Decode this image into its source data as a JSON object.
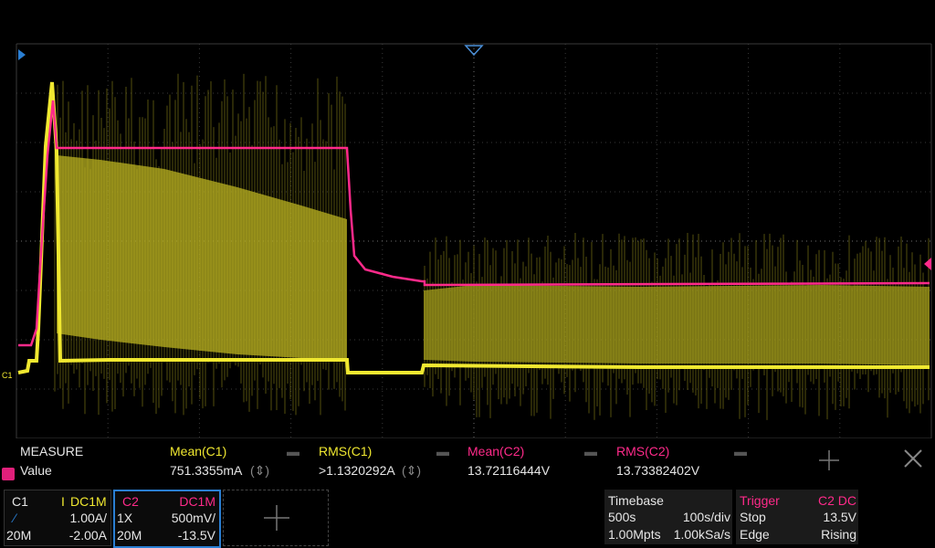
{
  "colors": {
    "ch1": "#f0e830",
    "ch2": "#ff2a8a",
    "grid": "#3a3a3a",
    "accent": "#2a7fd3"
  },
  "markers": {
    "ch1_label": "C1"
  },
  "measure": {
    "header": "MEASURE",
    "row_label": "Value",
    "columns": [
      {
        "name": "Mean(C1)",
        "value": "751.3355mA",
        "stat_icon": "updown-icon"
      },
      {
        "name": "RMS(C1)",
        "value": ">1.1320292A",
        "stat_icon": "updown-icon"
      },
      {
        "name": "Mean(C2)",
        "value": "13.72116444V"
      },
      {
        "name": "RMS(C2)",
        "value": "13.73382402V"
      }
    ]
  },
  "ch1": {
    "name": "C1",
    "type": "I",
    "coupling": "DC1M",
    "scale": "1.00A/",
    "bw": "20M",
    "offset": "-2.00A"
  },
  "ch2": {
    "name": "C2",
    "coupling": "DC1M",
    "probe": "1X",
    "scale": "500mV/",
    "bw": "20M",
    "offset": "-13.5V"
  },
  "timebase": {
    "title": "Timebase",
    "delay": "500s",
    "div": "100s/div",
    "mem": "1.00Mpts",
    "rate": "1.00kSa/s"
  },
  "trigger": {
    "title": "Trigger",
    "source": "C2 DC",
    "mode": "Stop",
    "level": "13.5V",
    "type": "Edge",
    "slope": "Rising"
  }
}
